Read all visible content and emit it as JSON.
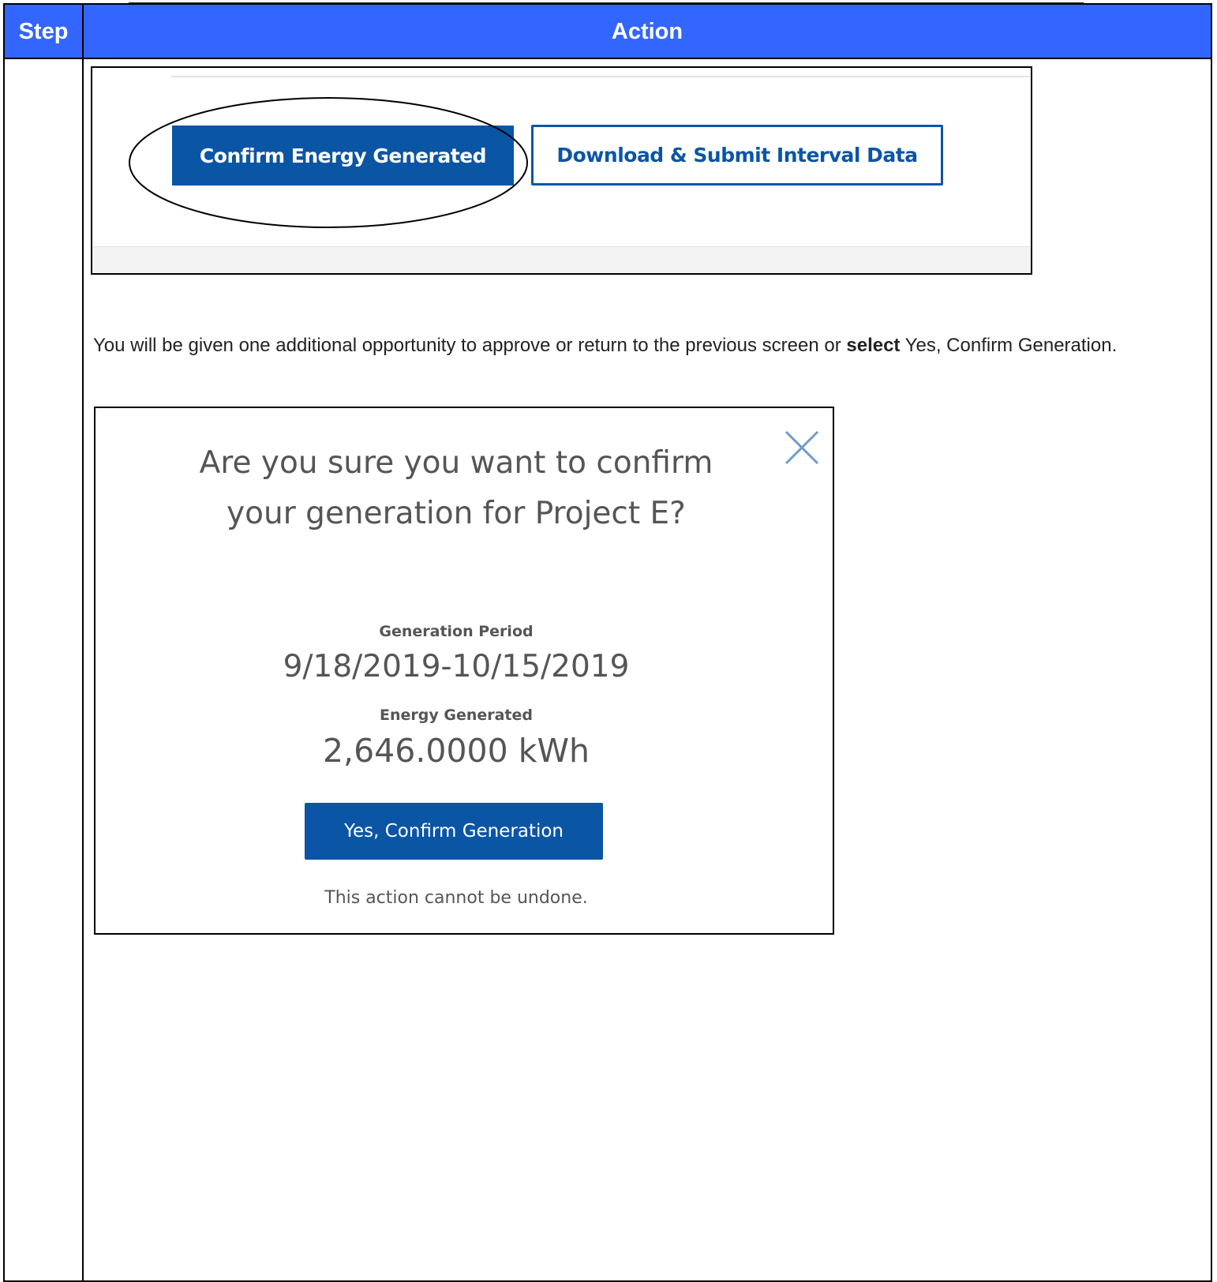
{
  "table": {
    "header": {
      "step": "Step",
      "action": "Action"
    }
  },
  "screenshot1": {
    "confirm_button": "Confirm Energy Generated",
    "download_button": "Download & Submit Interval Data"
  },
  "instruction": {
    "text_before": "You will be given one additional opportunity to approve or return to the previous screen or ",
    "bold": "select",
    "text_after": " Yes, Confirm Generation."
  },
  "modal": {
    "question": "Are you sure you want to confirm your generation for Project E?",
    "period_label": "Generation Period",
    "period_value": "9/18/2019-10/15/2019",
    "energy_label": "Energy Generated",
    "energy_value": "2,646.0000 kWh",
    "confirm_button": "Yes, Confirm Generation",
    "note": "This action cannot be undone.",
    "close_icon": "close-icon"
  },
  "colors": {
    "header_bg": "#3366ff",
    "primary_blue": "#0b55a5"
  }
}
